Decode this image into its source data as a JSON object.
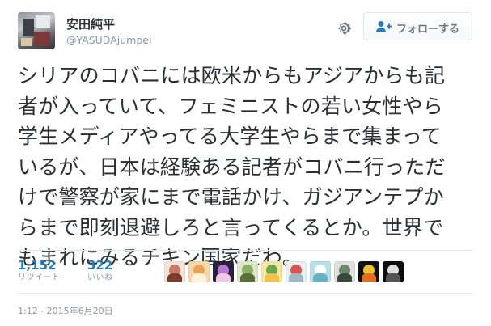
{
  "user": {
    "display_name": "安田純平",
    "handle": "@YASUDAjumpei",
    "avatar_icon": "profile-photo"
  },
  "actions": {
    "settings_icon": "gear-icon",
    "follow_icon": "person-add-icon",
    "follow_label": "フォローする"
  },
  "tweet": {
    "lines": [
      "シリアのコバニには欧米からもアジアからも記",
      "者が入っていて、フェミニストの若い女性やら",
      "学生メディアやってる大学生やらまで集まって",
      "いるが、日本は経験ある記者がコバニ行っただ",
      "けで警察が家にまで電話かけ、ガジアンテプか",
      "らまで即刻退避しろと言ってくるとか。世界で",
      "もまれにみるチキン国家だわ。"
    ]
  },
  "stats": {
    "retweets": {
      "count": "1,152",
      "label": "リツイート"
    },
    "likes": {
      "count": "322",
      "label": "いいね"
    }
  },
  "likers": [
    {
      "name": "liker-avatar-1",
      "colors": [
        "#f4e3d7",
        "#c97a6a",
        "#7a3d2a"
      ]
    },
    {
      "name": "liker-avatar-2",
      "colors": [
        "#f7d9a8",
        "#e8a25a",
        "#fff3dd"
      ]
    },
    {
      "name": "liker-avatar-3",
      "colors": [
        "#2a1f3d",
        "#b57ad0",
        "#f0c8e0"
      ]
    },
    {
      "name": "liker-avatar-4",
      "colors": [
        "#dce8c8",
        "#8fae6a",
        "#5a6e3c"
      ]
    },
    {
      "name": "liker-avatar-5",
      "colors": [
        "#f5e6a0",
        "#6aa84f",
        "#f2c14e"
      ]
    },
    {
      "name": "liker-avatar-6",
      "colors": [
        "#e8eef2",
        "#d9534f",
        "#9fb8c8"
      ]
    },
    {
      "name": "liker-avatar-7",
      "colors": [
        "#b8e0e8",
        "#ffffff",
        "#6ab0c4"
      ]
    },
    {
      "name": "liker-avatar-8",
      "colors": [
        "#e0e0e0",
        "#6e8a6e",
        "#3a4a3a"
      ]
    },
    {
      "name": "liker-avatar-9",
      "colors": [
        "#111111",
        "#f2c230",
        "#e07020"
      ]
    },
    {
      "name": "liker-avatar-10",
      "colors": [
        "#0d0d0d",
        "#dddddd",
        "#555555"
      ]
    }
  ],
  "timestamp": "1:12 - 2015年6月20日",
  "colors": {
    "text": "#292f33",
    "muted": "#8899a6",
    "link_blue": "#2b7bb9",
    "border": "#e1e8ed"
  }
}
